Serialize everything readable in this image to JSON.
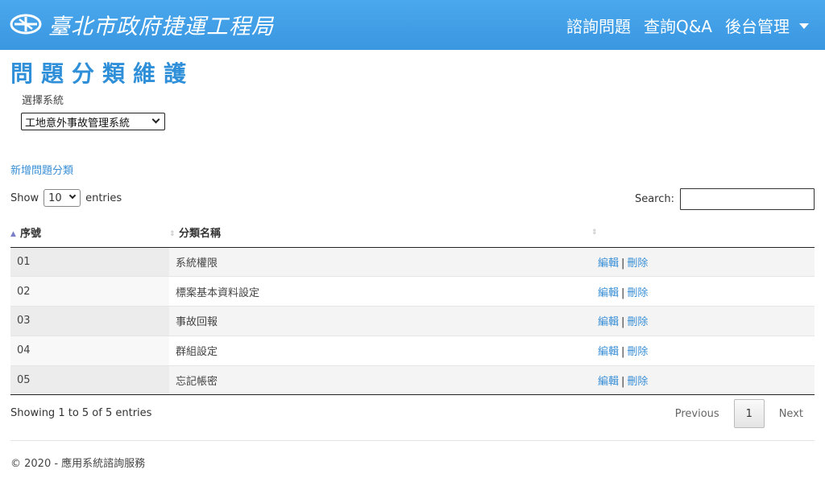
{
  "header": {
    "brand_text": "臺北市政府捷運工程局",
    "nav": [
      {
        "label": "諮詢問題"
      },
      {
        "label": "查詢Q&A"
      },
      {
        "label": "後台管理"
      }
    ],
    "color": "#3a9ee6"
  },
  "page": {
    "title": "問題分類維護",
    "system_label": "選擇系統",
    "system_selected": "工地意外事故管理系統",
    "add_link": "新增問題分類"
  },
  "table_controls": {
    "show_label": "Show",
    "length_value": "10",
    "entries_label": "entries",
    "search_label": "Search:",
    "search_value": ""
  },
  "table": {
    "headers": [
      "序號",
      "分類名稱",
      ""
    ],
    "rows": [
      {
        "no": "01",
        "name": "系統權限",
        "edit": "編輯",
        "delete": "刪除"
      },
      {
        "no": "02",
        "name": "標案基本資料設定",
        "edit": "編輯",
        "delete": "刪除"
      },
      {
        "no": "03",
        "name": "事故回報",
        "edit": "編輯",
        "delete": "刪除"
      },
      {
        "no": "04",
        "name": "群組設定",
        "edit": "編輯",
        "delete": "刪除"
      },
      {
        "no": "05",
        "name": "忘記帳密",
        "edit": "編輯",
        "delete": "刪除"
      }
    ],
    "separator": "|"
  },
  "pagination": {
    "info": "Showing 1 to 5 of 5 entries",
    "previous": "Previous",
    "current": "1",
    "next": "Next"
  },
  "footer": {
    "text": "© 2020 - 應用系統諮詢服務"
  },
  "colors": {
    "accent": "#2f8fd8",
    "link": "#3a8fd6"
  }
}
